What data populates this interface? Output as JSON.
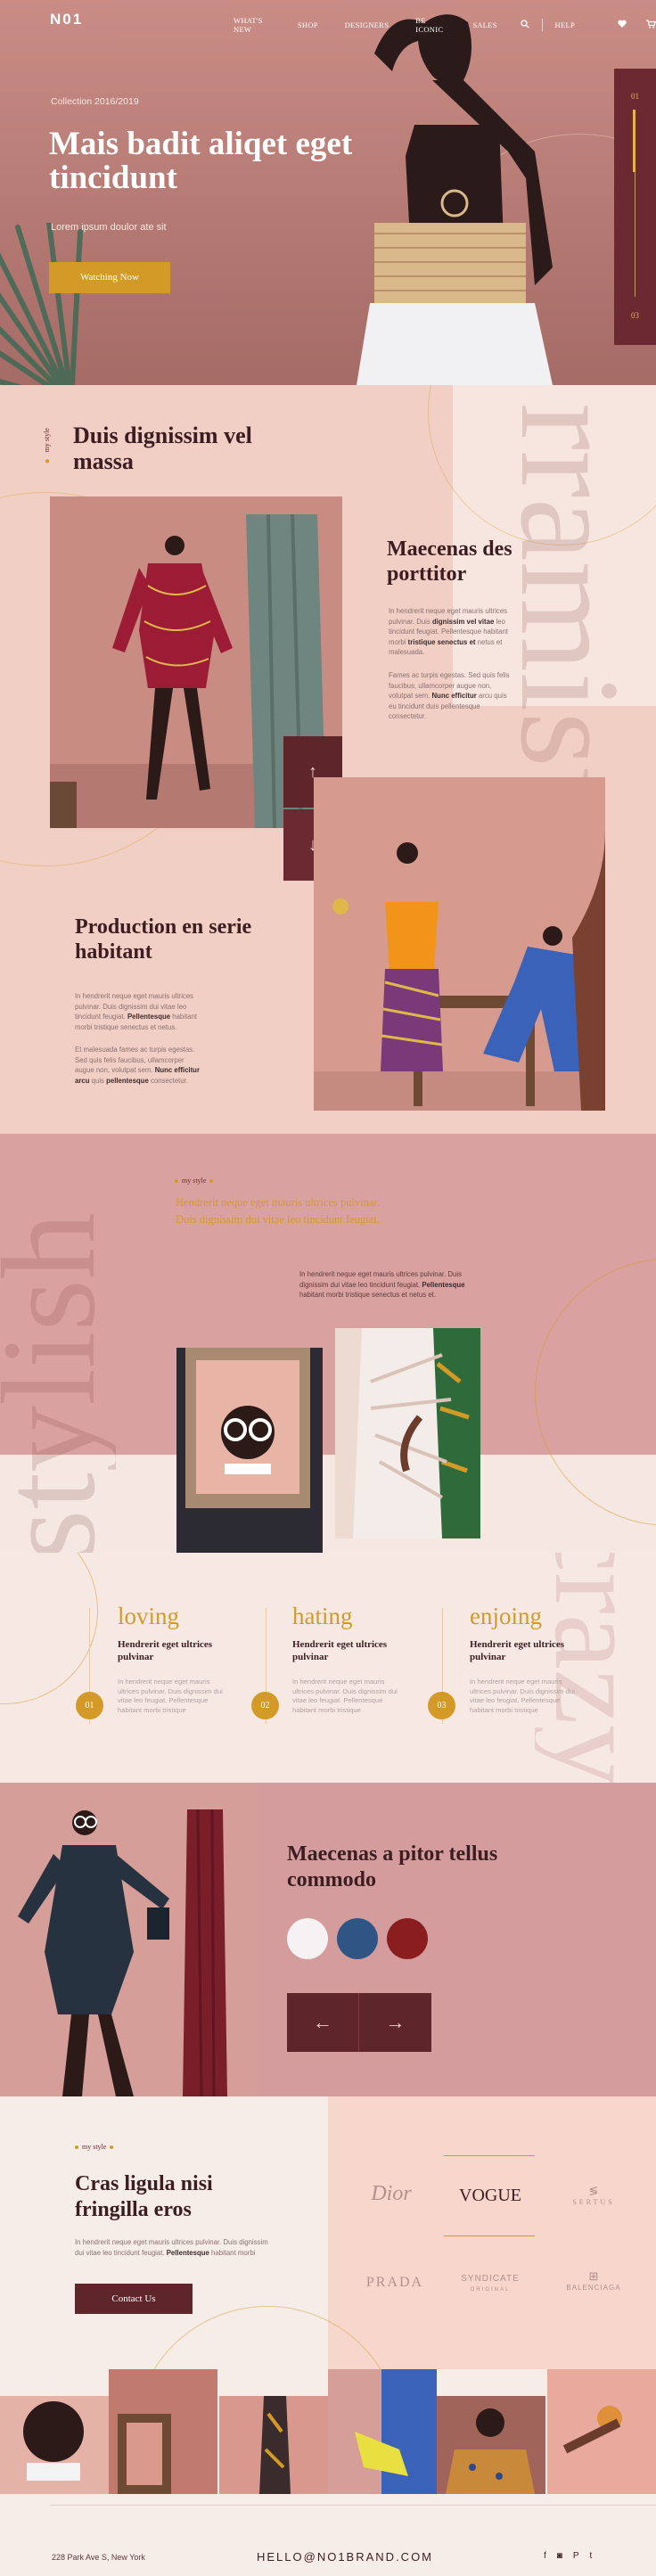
{
  "brand": {
    "logo": "N01"
  },
  "nav": {
    "items": [
      "WHAT'S NEW",
      "SHOP",
      "DESIGNERS",
      "BE ICONIC",
      "SALES"
    ],
    "help": "HELP",
    "icons": [
      "search-icon",
      "heart-icon",
      "cart-icon"
    ]
  },
  "hero": {
    "kicker": "Collection 2016/2019",
    "title": "Mais badit aliqet eget tincidunt",
    "subtitle": "Lorem ipsum doulor ate sit",
    "button": "Watching Now",
    "slider_top": "01",
    "slider_bottom": "03"
  },
  "section2": {
    "kicker": "my style",
    "title": "Duis dignissim vel massa",
    "watermark": "rramisu",
    "block1": {
      "title": "Maecenas des porttitor",
      "p1_a": "In hendrerit neque eget mauris ultrices pulvinar. Duis ",
      "p1_b": "dignissim vel vitae",
      "p1_c": " leo tincidunt feugiat. Pellentesque habitant morbi ",
      "p1_d": "tristique senectus et",
      "p1_e": " netus et malesuada.",
      "p2_a": "Fames ac turpis egestas. Sed quis felis faucibus, ullamcorper augue non, volutpat sem. ",
      "p2_b": "Nunc efficitur",
      "p2_c": " arcu quis eu tincidunt duis pellentesque consectetur."
    },
    "block2": {
      "title": "Production en serie habitant",
      "p1_a": "In hendrerit neque eget mauris ultrices pulvinar. Duis dignissim dui vitae leo tincidunt feugiat. ",
      "p1_b": "Pellentesque",
      "p1_c": " habitant morbi tristique senectus et netus.",
      "p2_a": "Et malesuada fames ac turpis egestas. Sed quis felis faucibus, ullamcorper augue non, volutpat sem. ",
      "p2_b": "Nunc efficitur arcu",
      "p2_c": " quis ",
      "p2_d": "pellentesque",
      "p2_e": " consectetur."
    },
    "arrow_up": "↑",
    "arrow_down": "↓"
  },
  "section3": {
    "kicker": "my style",
    "quote": "Hendrerit neque eget mauris ultrices pulvinar. Duis dignissim dui vitae leo tincidunt feugiat.",
    "body_a": "In hendrerit neque eget mauris ultrices pulvinar. Duis dignissim dui vitae leo tincidunt feugiat. ",
    "body_b": "Pellentesque",
    "body_c": " habitant morbi tristique senectus et netus et.",
    "watermark": "stylish"
  },
  "features": {
    "watermark": "crazy",
    "items": [
      {
        "title": "loving",
        "sub": "Hendrerit eget ultrices pulvinar",
        "body": "In hendrerit neque eget mauris ultrices pulvinar. Duis dignissim dui vitae leo feugiat. Pellentesque habitant morbi tristique",
        "num": "01"
      },
      {
        "title": "hating",
        "sub": "Hendrerit eget ultrices pulvinar",
        "body": "In hendrerit neque eget mauris ultrices pulvinar. Duis dignissim dui vitae leo feugiat. Pellentesque habitant morbi tristique",
        "num": "02"
      },
      {
        "title": "enjoing",
        "sub": "Hendrerit eget ultrices pulvinar",
        "body": "In hendrerit neque eget mauris ultrices pulvinar. Duis dignissim dui vitae leo feugiat. Pellentesque habitant morbi tristique",
        "num": "03"
      }
    ]
  },
  "section5": {
    "title": "Maecenas a pitor tellus commodo",
    "swatches": [
      "#f6f2f3",
      "#2f5584",
      "#8a1d1d"
    ],
    "arrow_prev": "←",
    "arrow_next": "→"
  },
  "section6": {
    "kicker": "my style",
    "title": "Cras ligula nisi fringilla eros",
    "body_a": "In hendrerit neque eget mauris ultrices pulvinar. Duis dignissim dui vitae leo tincidunt feugiat. ",
    "body_b": "Pellentesque",
    "body_c": " habitant morbi",
    "button": "Contact Us",
    "brands": [
      "Dior",
      "VOGUE",
      "SERTUS",
      "PRADA",
      "SYNDICATE",
      "ORIGINAL",
      "BALENCIAGA"
    ]
  },
  "footer": {
    "address": "228 Park Ave S, New York",
    "email": "HELLO@NO1BRAND.COM",
    "socials": [
      "facebook-icon",
      "instagram-icon",
      "pinterest-icon",
      "twitter-icon"
    ],
    "social_glyphs": [
      "f",
      "◙",
      "P",
      "t"
    ]
  },
  "colors": {
    "accent": "#d39a27",
    "burgundy": "#6b2a31",
    "blush": "#f1cfc4",
    "rose": "#d9a2a0"
  }
}
